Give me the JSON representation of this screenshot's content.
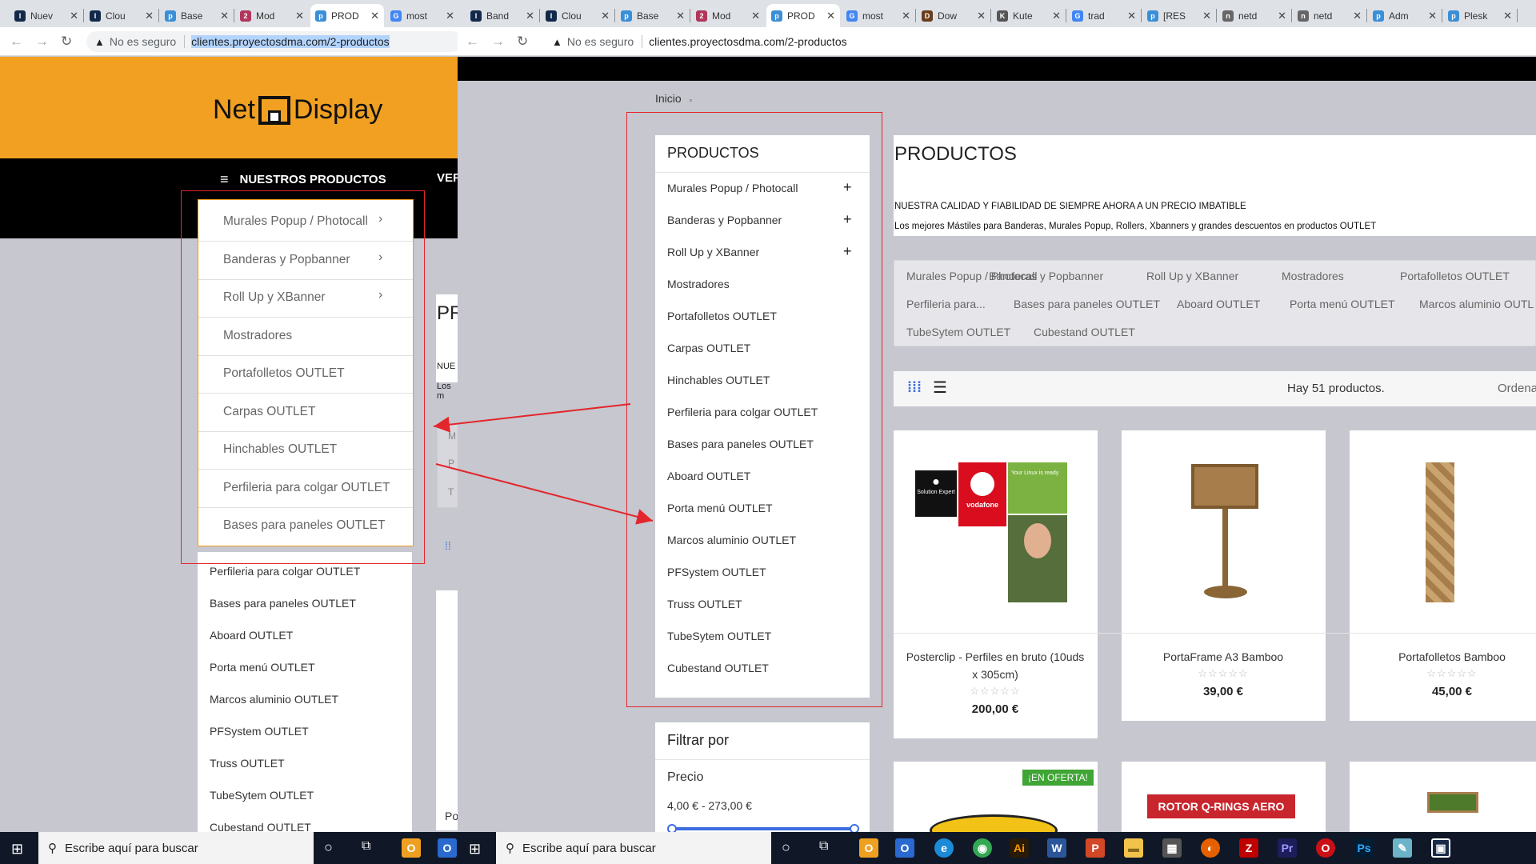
{
  "left_window": {
    "tabs": [
      {
        "label": "Nuev",
        "icon": "I"
      },
      {
        "label": "Clou",
        "icon": "I"
      },
      {
        "label": "Base",
        "icon": "pv"
      },
      {
        "label": "Mod",
        "icon": "26"
      },
      {
        "label": "PROD",
        "icon": "pv"
      },
      {
        "label": "most",
        "icon": "G"
      }
    ],
    "address": {
      "insecure_label": "No es seguro",
      "url": "clientes.proyectosdma.com/2-productos"
    },
    "logo": {
      "left": "Net",
      "right": "Display"
    },
    "menu": {
      "label": "NUESTROS PRODUCTOS",
      "next": "VER"
    },
    "dropdown": [
      "Murales Popup / Photocall",
      "Banderas y Popbanner",
      "Roll Up y XBanner",
      "Mostradores",
      "Portafolletos OUTLET",
      "Carpas OUTLET",
      "Hinchables OUTLET",
      "Perfileria para colgar OUTLET",
      "Bases para paneles OUTLET"
    ],
    "sidebar_below": [
      "Perfileria para colgar OUTLET",
      "Bases para paneles OUTLET",
      "Aboard OUTLET",
      "Porta menú OUTLET",
      "Marcos aluminio OUTLET",
      "PFSystem OUTLET",
      "Truss OUTLET",
      "TubeSytem OUTLET",
      "Cubestand OUTLET"
    ],
    "partial": {
      "title": "PR",
      "line1": "NUE",
      "line2": "Los m",
      "c1": "M",
      "c2": "P",
      "c3": "T",
      "bottom": "Po"
    }
  },
  "right_window": {
    "tabs": [
      {
        "label": "Band",
        "icon": "I"
      },
      {
        "label": "Clou",
        "icon": "I"
      },
      {
        "label": "Base",
        "icon": "pv"
      },
      {
        "label": "Mod",
        "icon": "26"
      },
      {
        "label": "PROD",
        "icon": "pv"
      },
      {
        "label": "most",
        "icon": "G"
      },
      {
        "label": "Dow",
        "icon": "D"
      },
      {
        "label": "Kute",
        "icon": "K"
      },
      {
        "label": "trad",
        "icon": "G"
      },
      {
        "label": "[RES",
        "icon": "pv"
      },
      {
        "label": "netd",
        "icon": "n"
      },
      {
        "label": "netd",
        "icon": "n"
      },
      {
        "label": "Adm",
        "icon": "pv"
      },
      {
        "label": "Plesk",
        "icon": "pv"
      }
    ],
    "address": {
      "insecure_label": "No es seguro",
      "url": "clientes.proyectosdma.com/2-productos"
    },
    "breadcrumb": "Inicio",
    "sidebar": {
      "title": "PRODUCTOS",
      "items": [
        {
          "label": "Murales Popup / Photocall",
          "expand": "+"
        },
        {
          "label": "Banderas y Popbanner",
          "expand": "+"
        },
        {
          "label": "Roll Up y XBanner",
          "expand": "+"
        },
        {
          "label": "Mostradores",
          "expand": ""
        },
        {
          "label": "Portafolletos OUTLET",
          "expand": ""
        },
        {
          "label": "Carpas OUTLET",
          "expand": ""
        },
        {
          "label": "Hinchables OUTLET",
          "expand": ""
        },
        {
          "label": "Perfileria para colgar OUTLET",
          "expand": ""
        },
        {
          "label": "Bases para paneles OUTLET",
          "expand": ""
        },
        {
          "label": "Aboard OUTLET",
          "expand": ""
        },
        {
          "label": "Porta menú OUTLET",
          "expand": ""
        },
        {
          "label": "Marcos aluminio OUTLET",
          "expand": ""
        },
        {
          "label": "PFSystem OUTLET",
          "expand": ""
        },
        {
          "label": "Truss OUTLET",
          "expand": ""
        },
        {
          "label": "TubeSytem OUTLET",
          "expand": ""
        },
        {
          "label": "Cubestand OUTLET",
          "expand": ""
        }
      ]
    },
    "filter": {
      "title": "Filtrar por",
      "price_label": "Precio",
      "price_range": "4,00 € - 273,00 €"
    },
    "main": {
      "title": "PRODUCTOS",
      "desc1": "NUESTRA CALIDAD Y FIABILIDAD DE SIEMPRE AHORA A UN PRECIO IMBATIBLE",
      "desc2": "Los mejores Mástiles para Banderas, Murales Popup, Rollers, Xbanners y grandes descuentos en productos OUTLET",
      "categories_row1": [
        "Murales Popup / Photocall",
        "Banderas y Popbanner",
        "Roll Up y XBanner",
        "Mostradores",
        "Portafolletos OUTLET"
      ],
      "categories_row2": [
        "Perfileria para...",
        "Bases para paneles OUTLET",
        "Aboard OUTLET",
        "Porta menú OUTLET",
        "Marcos aluminio OUTL"
      ],
      "categories_row3": [
        "TubeSytem OUTLET",
        "Cubestand OUTLET"
      ],
      "count": "Hay 51 productos.",
      "sort": "Ordena",
      "products": [
        {
          "name": "Posterclip - Perfiles en bruto (10uds x 305cm)",
          "price": "200,00 €",
          "rating": "☆☆☆☆☆"
        },
        {
          "name": "PortaFrame A3 Bamboo",
          "price": "39,00 €",
          "rating": "☆☆☆☆☆"
        },
        {
          "name": "Portafolletos Bamboo",
          "price": "45,00 €",
          "rating": "☆☆☆☆☆"
        }
      ],
      "offer_badge": "¡EN OFERTA!",
      "rotor_text": "ROTOR Q-RINGS AERO",
      "poster_labels": {
        "apple": "Solution Expert",
        "vodafone": "vodafone",
        "linux": "Your Linux is ready"
      }
    }
  },
  "taskbar": {
    "search_left": "Escribe aquí para buscar",
    "search_right": "Escribe aquí para buscar"
  }
}
